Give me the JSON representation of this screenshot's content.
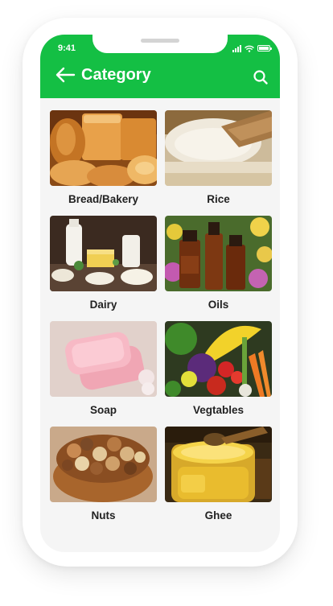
{
  "status_bar": {
    "time": "9:41"
  },
  "header": {
    "title": "Category",
    "back_icon": "arrow-left-icon",
    "search_icon": "search-icon"
  },
  "colors": {
    "accent": "#14bf44",
    "background": "#f5f5f5",
    "label": "#222222"
  },
  "categories": [
    {
      "label": "Bread/Bakery",
      "image": "bread-image"
    },
    {
      "label": "Rice",
      "image": "rice-image"
    },
    {
      "label": "Dairy",
      "image": "dairy-image"
    },
    {
      "label": "Oils",
      "image": "oils-image"
    },
    {
      "label": "Soap",
      "image": "soap-image"
    },
    {
      "label": "Vegtables",
      "image": "vegetables-image"
    },
    {
      "label": "Nuts",
      "image": "nuts-image"
    },
    {
      "label": "Ghee",
      "image": "ghee-image"
    }
  ]
}
